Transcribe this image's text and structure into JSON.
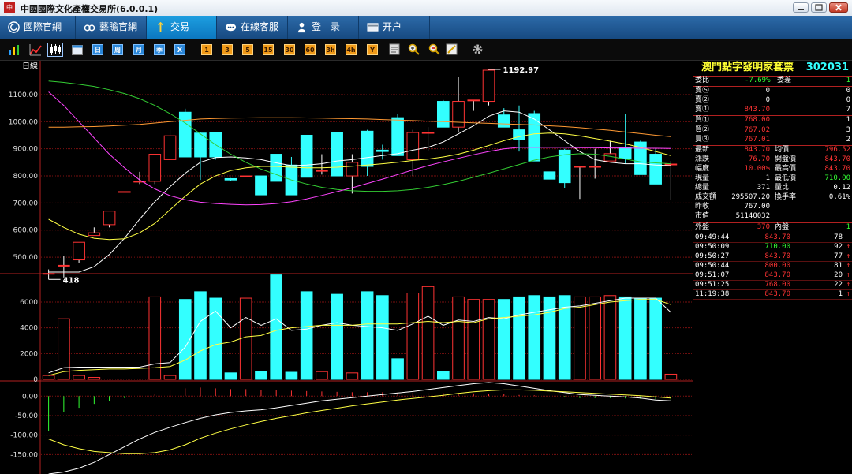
{
  "window": {
    "title": "中國國際文化產權交易所(6.0.0.1)",
    "icon_text": "中国"
  },
  "nav": [
    {
      "label": "國際官網",
      "icon": "globe-icon"
    },
    {
      "label": "藝贍官網",
      "icon": "link-icon"
    },
    {
      "label": "交易",
      "icon": "trade-icon"
    },
    {
      "label": "在線客服",
      "icon": "chat-icon"
    },
    {
      "label": "登　录",
      "icon": "user-icon"
    },
    {
      "label": "开户",
      "icon": "card-icon"
    }
  ],
  "toolbar": {
    "views": [
      "bar-chart-icon",
      "line-chart-icon",
      "candlestick-icon",
      "calendar-icon"
    ],
    "periods": [
      "日",
      "周",
      "月",
      "季",
      "X"
    ],
    "minutes": [
      "1",
      "3",
      "5",
      "15",
      "30",
      "60",
      "3h",
      "4h",
      "Y"
    ],
    "tools": [
      "zoom-in-icon",
      "zoom-out-icon",
      "draw-icon",
      "settings-icon"
    ]
  },
  "chart_labels": {
    "period": "日線",
    "high_label": "1192.97",
    "low_label": "418"
  },
  "chart_data": [
    {
      "type": "candlestick",
      "title": "日線",
      "ylim": [
        445,
        1225
      ],
      "yticks": [
        500,
        600,
        700,
        800,
        900,
        1000,
        1100
      ],
      "ytick_labels": [
        "500.00",
        "600.00",
        "700.00",
        "800.00",
        "900.00",
        "1000.00",
        "1100.00"
      ],
      "annotations": [
        {
          "text": "1192.97"
        },
        {
          "text": "418"
        }
      ],
      "candles": [
        [
          440,
          440,
          418,
          455
        ],
        [
          470,
          470,
          425,
          505
        ],
        [
          490,
          555,
          480,
          555
        ],
        [
          580,
          590,
          580,
          610
        ],
        [
          620,
          670,
          610,
          670
        ],
        [
          740,
          742,
          740,
          742
        ],
        [
          780,
          780,
          770,
          815
        ],
        [
          780,
          880,
          770,
          880
        ],
        [
          860,
          948,
          860,
          970
        ],
        [
          1035,
          870,
          870,
          1048
        ],
        [
          958,
          870,
          785,
          962
        ],
        [
          960,
          870,
          860,
          962
        ],
        [
          790,
          785,
          782,
          792
        ],
        [
          800,
          800,
          795,
          800
        ],
        [
          800,
          730,
          730,
          800
        ],
        [
          880,
          780,
          780,
          880
        ],
        [
          840,
          730,
          730,
          870
        ],
        [
          950,
          795,
          795,
          950
        ],
        [
          820,
          820,
          805,
          880
        ],
        [
          960,
          800,
          800,
          960
        ],
        [
          800,
          850,
          735,
          880
        ],
        [
          965,
          835,
          800,
          970
        ],
        [
          895,
          890,
          860,
          915
        ],
        [
          1015,
          875,
          875,
          1030
        ],
        [
          860,
          960,
          800,
          970
        ],
        [
          960,
          960,
          890,
          980
        ],
        [
          1075,
          980,
          980,
          1080
        ],
        [
          980,
          1075,
          960,
          1165
        ],
        [
          1080,
          1080,
          1040,
          1080
        ],
        [
          1075,
          1190,
          1060,
          1192.97
        ],
        [
          1025,
          980,
          980,
          1050
        ],
        [
          970,
          935,
          890,
          1060
        ],
        [
          1030,
          855,
          855,
          1040
        ],
        [
          815,
          788,
          788,
          815
        ],
        [
          895,
          775,
          755,
          900
        ],
        [
          835,
          835,
          715,
          835
        ],
        [
          835,
          835,
          790,
          900
        ],
        [
          855,
          882,
          855,
          930
        ],
        [
          905,
          865,
          845,
          1030
        ],
        [
          925,
          805,
          805,
          930
        ],
        [
          880,
          770,
          770,
          900
        ],
        [
          843.7,
          843.7,
          710,
          855
        ]
      ],
      "ma": [
        {
          "name": "MA5",
          "color": "#ffffff",
          "values": [
            420,
            420,
            438,
            465,
            510,
            570,
            640,
            705,
            760,
            810,
            850,
            868,
            870,
            866,
            860,
            848,
            838,
            840,
            845,
            855,
            860,
            868,
            875,
            882,
            895,
            905,
            925,
            955,
            985,
            1020,
            1040,
            1035,
            1010,
            970,
            930,
            890,
            860,
            850,
            845,
            845,
            840,
            838
          ]
        },
        {
          "name": "MA10",
          "color": "#ffff44",
          "values": [
            640,
            610,
            585,
            570,
            565,
            568,
            590,
            625,
            675,
            725,
            770,
            800,
            820,
            830,
            835,
            835,
            832,
            830,
            830,
            832,
            836,
            840,
            845,
            850,
            857,
            862,
            870,
            880,
            895,
            912,
            930,
            945,
            955,
            958,
            955,
            948,
            938,
            928,
            918,
            905,
            890,
            875
          ]
        },
        {
          "name": "MA20",
          "color": "#33cc33",
          "values": [
            1150,
            1145,
            1138,
            1130,
            1118,
            1104,
            1085,
            1060,
            1030,
            995,
            955,
            915,
            880,
            850,
            825,
            805,
            785,
            770,
            758,
            750,
            745,
            743,
            743,
            745,
            750,
            758,
            768,
            780,
            795,
            810,
            826,
            842,
            858,
            870,
            878,
            882,
            880,
            872,
            862,
            852,
            848,
            845
          ]
        },
        {
          "name": "MA30",
          "color": "#ff44ff",
          "values": [
            1110,
            1060,
            1000,
            940,
            880,
            830,
            785,
            752,
            727,
            712,
            703,
            698,
            695,
            693,
            694,
            698,
            705,
            715,
            728,
            742,
            756,
            772,
            788,
            805,
            822,
            838,
            852,
            865,
            878,
            890,
            900,
            905,
            905,
            905,
            905,
            904,
            904,
            903,
            903,
            902,
            902,
            901
          ]
        },
        {
          "name": "MA60",
          "color": "#ff9933",
          "values": [
            980,
            980,
            981,
            982,
            984,
            987,
            990,
            995,
            1000,
            1005,
            1010,
            1012,
            1013,
            1014,
            1015,
            1015,
            1015,
            1014,
            1013,
            1012,
            1011,
            1010,
            1008,
            1006,
            1004,
            1002,
            1000,
            998,
            996,
            994,
            992,
            990,
            988,
            985,
            982,
            978,
            973,
            968,
            962,
            956,
            950,
            945
          ]
        }
      ]
    },
    {
      "type": "bar",
      "title": "成交量",
      "ylim": [
        0,
        8200
      ],
      "yticks": [
        0,
        2000,
        4000,
        6000
      ],
      "ytick_labels": [
        "0",
        "2000",
        "4000",
        "6000"
      ],
      "values": [
        300,
        4700,
        300,
        150,
        0,
        0,
        0,
        6400,
        300,
        6200,
        6800,
        6300,
        500,
        6300,
        600,
        8100,
        550,
        6800,
        600,
        6600,
        500,
        6800,
        6500,
        1600,
        6700,
        7200,
        600,
        6400,
        6200,
        6200,
        6200,
        6400,
        6500,
        6400,
        6500,
        6400,
        6400,
        6500,
        6400,
        6300,
        6300,
        400
      ],
      "ma": [
        {
          "name": "VMA5",
          "color": "#ffffff",
          "values": [
            500,
            900,
            950,
            950,
            950,
            950,
            950,
            1200,
            1300,
            2500,
            4500,
            5300,
            4000,
            4800,
            4200,
            4700,
            3800,
            3900,
            4200,
            4400,
            4200,
            4100,
            4000,
            3800,
            4300,
            4900,
            4200,
            4600,
            4500,
            4800,
            4700,
            5000,
            5200,
            5400,
            5600,
            5700,
            5900,
            6100,
            6300,
            6300,
            6300,
            5200
          ]
        },
        {
          "name": "VMA10",
          "color": "#ffff44",
          "values": [
            300,
            600,
            700,
            750,
            800,
            800,
            850,
            900,
            1000,
            1500,
            2200,
            2700,
            2900,
            3300,
            3400,
            3800,
            4000,
            4100,
            4200,
            4200,
            4200,
            4300,
            4300,
            4300,
            4400,
            4500,
            4400,
            4500,
            4400,
            4700,
            4800,
            4900,
            5000,
            5200,
            5500,
            5600,
            5800,
            6000,
            6100,
            6200,
            6200,
            5800
          ]
        }
      ]
    },
    {
      "type": "bar",
      "title": "MACD",
      "ylim": [
        -200,
        35
      ],
      "yticks": [
        0,
        -50,
        -100,
        -150
      ],
      "ytick_labels": [
        "0.00",
        "-50.00",
        "-100.00",
        "-150.00"
      ],
      "values": [
        -90,
        -40,
        -30,
        -20,
        -12,
        -5,
        0,
        5,
        15,
        20,
        22,
        20,
        18,
        18,
        16,
        15,
        14,
        13,
        12,
        11,
        10,
        10,
        10,
        9,
        9,
        8,
        8,
        7,
        7,
        6,
        5,
        3,
        2,
        0,
        -3,
        -5,
        -5,
        -5,
        -6,
        -7,
        -8,
        -10
      ],
      "ma": [
        {
          "name": "DIF",
          "color": "#ffffff",
          "values": [
            -200,
            -195,
            -185,
            -170,
            -150,
            -130,
            -110,
            -93,
            -80,
            -68,
            -57,
            -48,
            -42,
            -38,
            -35,
            -30,
            -24,
            -18,
            -12,
            -8,
            -4,
            0,
            4,
            8,
            12,
            17,
            22,
            27,
            32,
            35,
            32,
            26,
            20,
            14,
            9,
            4,
            2,
            0,
            -2,
            -5,
            -10,
            -12
          ]
        },
        {
          "name": "DEA",
          "color": "#ffff44",
          "values": [
            -110,
            -125,
            -135,
            -142,
            -145,
            -148,
            -148,
            -145,
            -138,
            -125,
            -108,
            -95,
            -84,
            -74,
            -65,
            -57,
            -50,
            -43,
            -37,
            -31,
            -25,
            -20,
            -15,
            -10,
            -6,
            -2,
            2,
            7,
            11,
            14,
            16,
            16,
            15,
            13,
            11,
            9,
            7,
            5,
            3,
            1,
            -2,
            -5
          ]
        }
      ]
    }
  ],
  "panel": {
    "name": "澳門點字發明家套票",
    "code": "302031",
    "colors": {
      "up": "#ff3333",
      "down": "#33ff33",
      "flat": "#ffffff",
      "label": "#ffffff",
      "border": "#b22020"
    },
    "weibi": {
      "label": "委比",
      "value": "-7.69%",
      "label2": "委差",
      "value2": "1"
    },
    "asks": [
      {
        "label": "賣⑤",
        "price": "0",
        "vol": "0",
        "c": "flat"
      },
      {
        "label": "賣②",
        "price": "0",
        "vol": "0",
        "c": "flat"
      },
      {
        "label": "賣①",
        "price": "843.70",
        "vol": "7",
        "c": "up"
      }
    ],
    "bids": [
      {
        "label": "買①",
        "price": "768.00",
        "vol": "1",
        "c": "up"
      },
      {
        "label": "買②",
        "price": "767.02",
        "vol": "3",
        "c": "up"
      },
      {
        "label": "買③",
        "price": "767.01",
        "vol": "2",
        "c": "up"
      }
    ],
    "stats": [
      {
        "l1": "最新",
        "v1": "843.70",
        "c1": "up",
        "l2": "均價",
        "v2": "796.52",
        "c2": "up"
      },
      {
        "l1": "漲跌",
        "v1": "76.70",
        "c1": "up",
        "l2": "開盤價",
        "v2": "843.70",
        "c2": "up"
      },
      {
        "l1": "幅度",
        "v1": "10.00%",
        "c1": "up",
        "l2": "最高價",
        "v2": "843.70",
        "c2": "up"
      },
      {
        "l1": "現量",
        "v1": "1",
        "c1": "flat",
        "l2": "最低價",
        "v2": "710.00",
        "c2": "down"
      },
      {
        "l1": "總量",
        "v1": "371",
        "c1": "flat",
        "l2": "量比",
        "v2": "0.12",
        "c2": "flat"
      },
      {
        "l1": "成交額",
        "v1": "295507.20",
        "c1": "flat",
        "l2": "換手率",
        "v2": "0.61%",
        "c2": "flat"
      },
      {
        "l1": "昨收",
        "v1": "767.00",
        "c1": "flat",
        "l2": "",
        "v2": "",
        "c2": "flat"
      },
      {
        "l1": "市值",
        "v1": "51140032",
        "c1": "flat",
        "l2": "",
        "v2": "",
        "c2": "flat"
      }
    ],
    "outer": {
      "l1": "外盤",
      "v1": "370",
      "l2": "內盤",
      "v2": "1"
    },
    "ticks": [
      {
        "time": "09:49:44",
        "price": "843.70",
        "vol": "78",
        "dir": "—",
        "c": "up"
      },
      {
        "time": "09:50:09",
        "price": "710.00",
        "vol": "92",
        "dir": "↑",
        "c": "down"
      },
      {
        "time": "09:50:27",
        "price": "843.70",
        "vol": "77",
        "dir": "↑",
        "c": "up"
      },
      {
        "time": "09:50:44",
        "price": "800.00",
        "vol": "81",
        "dir": "↑",
        "c": "up"
      },
      {
        "time": "09:51:07",
        "price": "843.70",
        "vol": "20",
        "dir": "↑",
        "c": "up"
      },
      {
        "time": "09:51:25",
        "price": "768.00",
        "vol": "22",
        "dir": "↑",
        "c": "up"
      },
      {
        "time": "11:19:38",
        "price": "843.70",
        "vol": "1",
        "dir": "↑",
        "c": "up"
      }
    ]
  }
}
